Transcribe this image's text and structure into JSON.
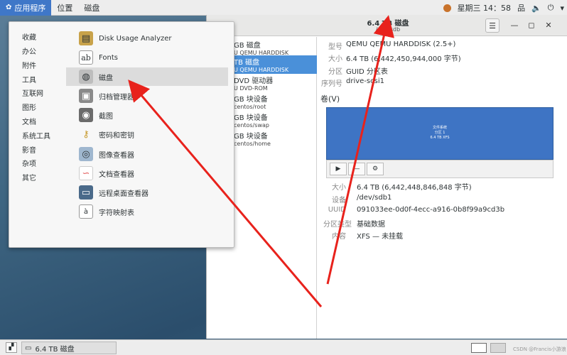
{
  "topbar": {
    "apps_label": "应用程序",
    "places_label": "位置",
    "active_app": "磁盘",
    "clock": "星期三 14：58"
  },
  "window": {
    "title": "6.4 TB 磁盘",
    "subtitle": "/dev/sdb"
  },
  "devices": [
    {
      "title": "GB 磁盘",
      "sub": "U QEMU HARDDISK"
    },
    {
      "title": "TB 磁盘",
      "sub": "U QEMU HARDDISK"
    },
    {
      "title": "DVD 驱动器",
      "sub": "U DVD-ROM"
    },
    {
      "title": "GB 块设备",
      "sub": "centos/root"
    },
    {
      "title": "GB 块设备",
      "sub": "centos/swap"
    },
    {
      "title": "GB 块设备",
      "sub": "centos/home"
    }
  ],
  "drive_props": [
    {
      "label": "型号",
      "value": "QEMU QEMU HARDDISK (2.5+)"
    },
    {
      "label": "大小",
      "value": "6.4 TB (6,442,450,944,000 字节)"
    },
    {
      "label": "分区",
      "value": "GUID 分区表"
    },
    {
      "label": "序列号",
      "value": "drive-scsi1"
    }
  ],
  "volumes_title": "卷(V)",
  "volume_map": {
    "line1": "文件系统",
    "line2": "分区 1",
    "line3": "6.4 TB XFS"
  },
  "volume_props": [
    {
      "label": "大小",
      "value": "6.4 TB (6,442,448,846,848 字节)"
    },
    {
      "label": "设备",
      "value": "/dev/sdb1"
    },
    {
      "label": "UUID",
      "value": "091033ee-0d0f-4ecc-a916-0b8f99a9cd3b"
    },
    {
      "label": "分区类型",
      "value": "基础数据"
    },
    {
      "label": "内容",
      "value": "XFS — 未挂载"
    }
  ],
  "menu": {
    "categories": [
      "收藏",
      "办公",
      "附件",
      "工具",
      "互联网",
      "图形",
      "文档",
      "系统工具",
      "影音",
      "杂项",
      "其它"
    ],
    "apps": [
      {
        "label": "Disk Usage Analyzer",
        "icon": "folder-chart-icon",
        "color": "#c8a24a"
      },
      {
        "label": "Fonts",
        "icon": "fonts-icon",
        "color": "#ffffff"
      },
      {
        "label": "磁盘",
        "icon": "disk-icon",
        "color": "#bdbdbd"
      },
      {
        "label": "归档管理器",
        "icon": "archive-icon",
        "color": "#8a8a8a"
      },
      {
        "label": "截图",
        "icon": "screenshot-icon",
        "color": "#6b6b6b"
      },
      {
        "label": "密码和密钥",
        "icon": "keys-icon",
        "color": "#d6b04a"
      },
      {
        "label": "图像查看器",
        "icon": "image-viewer-icon",
        "color": "#9fb7cf"
      },
      {
        "label": "文档查看器",
        "icon": "document-viewer-icon",
        "color": "#e25b5b"
      },
      {
        "label": "远程桌面查看器",
        "icon": "remote-desktop-icon",
        "color": "#4a6a8a"
      },
      {
        "label": "字符映射表",
        "icon": "character-map-icon",
        "color": "#ffffff"
      }
    ]
  },
  "taskbar": {
    "window_label": "6.4 TB 磁盘",
    "watermark": "CSDN @Francis小游浪"
  },
  "colors": {
    "accent": "#3f77c8",
    "selection": "#4a90d9",
    "volume": "#3e74c4",
    "annotation": "#e8221c"
  }
}
